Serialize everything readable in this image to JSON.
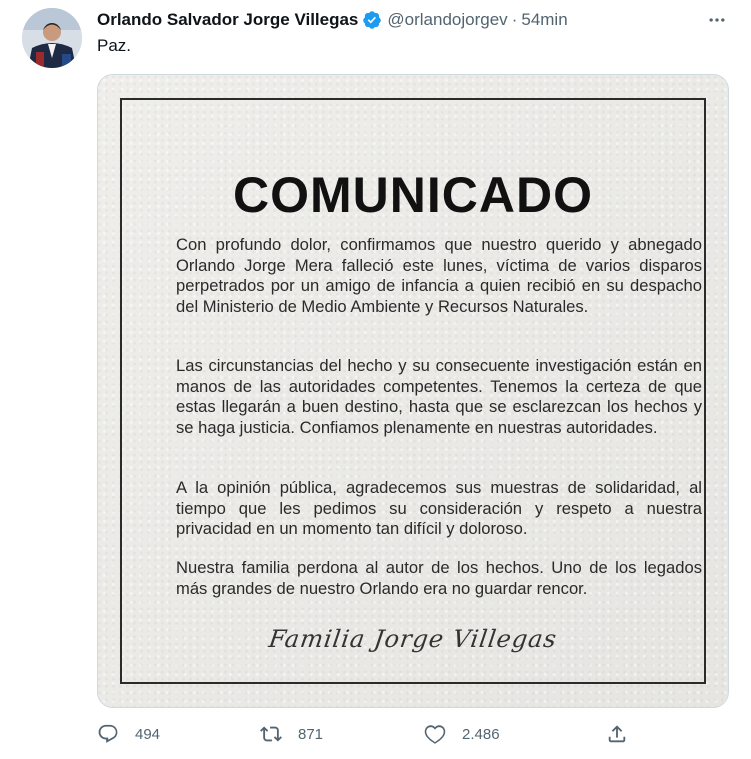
{
  "author": {
    "display_name": "Orlando Salvador Jorge Villegas",
    "handle": "@orlandojorgev",
    "separator": "·",
    "time": "54min",
    "verified": true
  },
  "tweet": {
    "text": "Paz."
  },
  "media": {
    "title": "COMUNICADO",
    "paragraphs": [
      "Con profundo dolor, confirmamos que nuestro querido y abnegado Orlando Jorge Mera falleció este lunes, víctima de varios disparos perpetrados por un amigo de infancia a quien recibió en su despacho del Ministerio de Medio Ambiente y Recursos Naturales.",
      "Las circunstancias del hecho y su consecuente investigación están en manos de las autoridades competentes. Tenemos la certeza de que estas llegarán a buen destino, hasta que se esclarezcan los hechos y se haga justicia. Confiamos plenamente en nuestras autoridades.",
      "A la opinión pública, agradecemos sus muestras de solidaridad, al tiempo que les pedimos su consideración y respeto a nuestra privacidad en un momento tan difícil y doloroso.",
      "Nuestra familia perdona al autor de los hechos. Uno de los legados más grandes de nuestro Orlando era no guardar rencor."
    ],
    "signature": "Familia Jorge Villegas"
  },
  "actions": {
    "replies": "494",
    "retweets": "871",
    "likes": "2.486"
  },
  "icons": {
    "verified": "verified-badge-icon",
    "more": "more-icon",
    "reply": "reply-icon",
    "retweet": "retweet-icon",
    "like": "heart-icon",
    "share": "share-icon"
  },
  "colors": {
    "verified_blue": "#1d9bf0",
    "secondary_text": "#536471",
    "primary_text": "#0f1419"
  }
}
